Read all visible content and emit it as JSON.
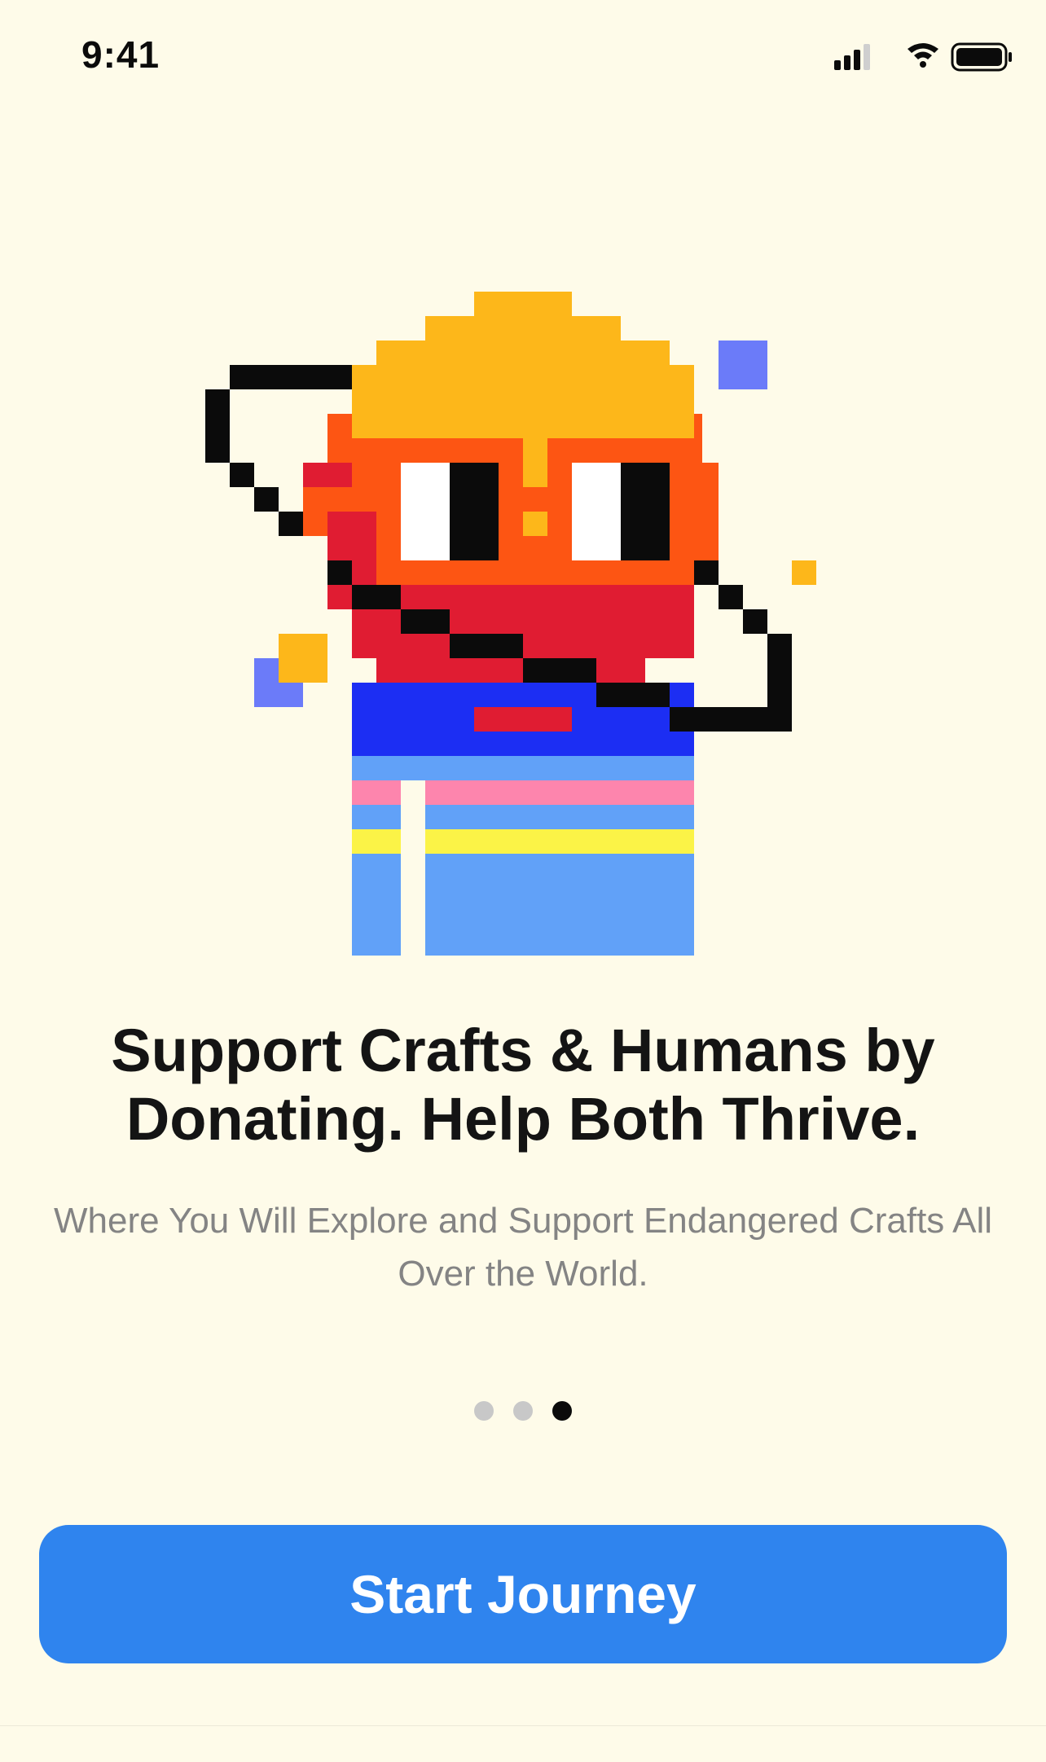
{
  "status_bar": {
    "time": "9:41",
    "icons": [
      "signal-icon",
      "wifi-icon",
      "battery-icon"
    ]
  },
  "onboarding": {
    "illustration": "pixel-character-illustration",
    "title": "Support Crafts & Humans by Donating. Help Both Thrive.",
    "subtitle": "Where You Will Explore and Support Endangered Crafts All Over the World.",
    "page_count": 3,
    "current_page": 3
  },
  "cta": {
    "label": "Start Journey",
    "color": "#2F84EE"
  },
  "colors": {
    "background": "#FEFBE9",
    "title": "#141414",
    "subtitle": "#848484",
    "dot_inactive": "#C8C8C8",
    "dot_active": "#0B0B0B"
  }
}
